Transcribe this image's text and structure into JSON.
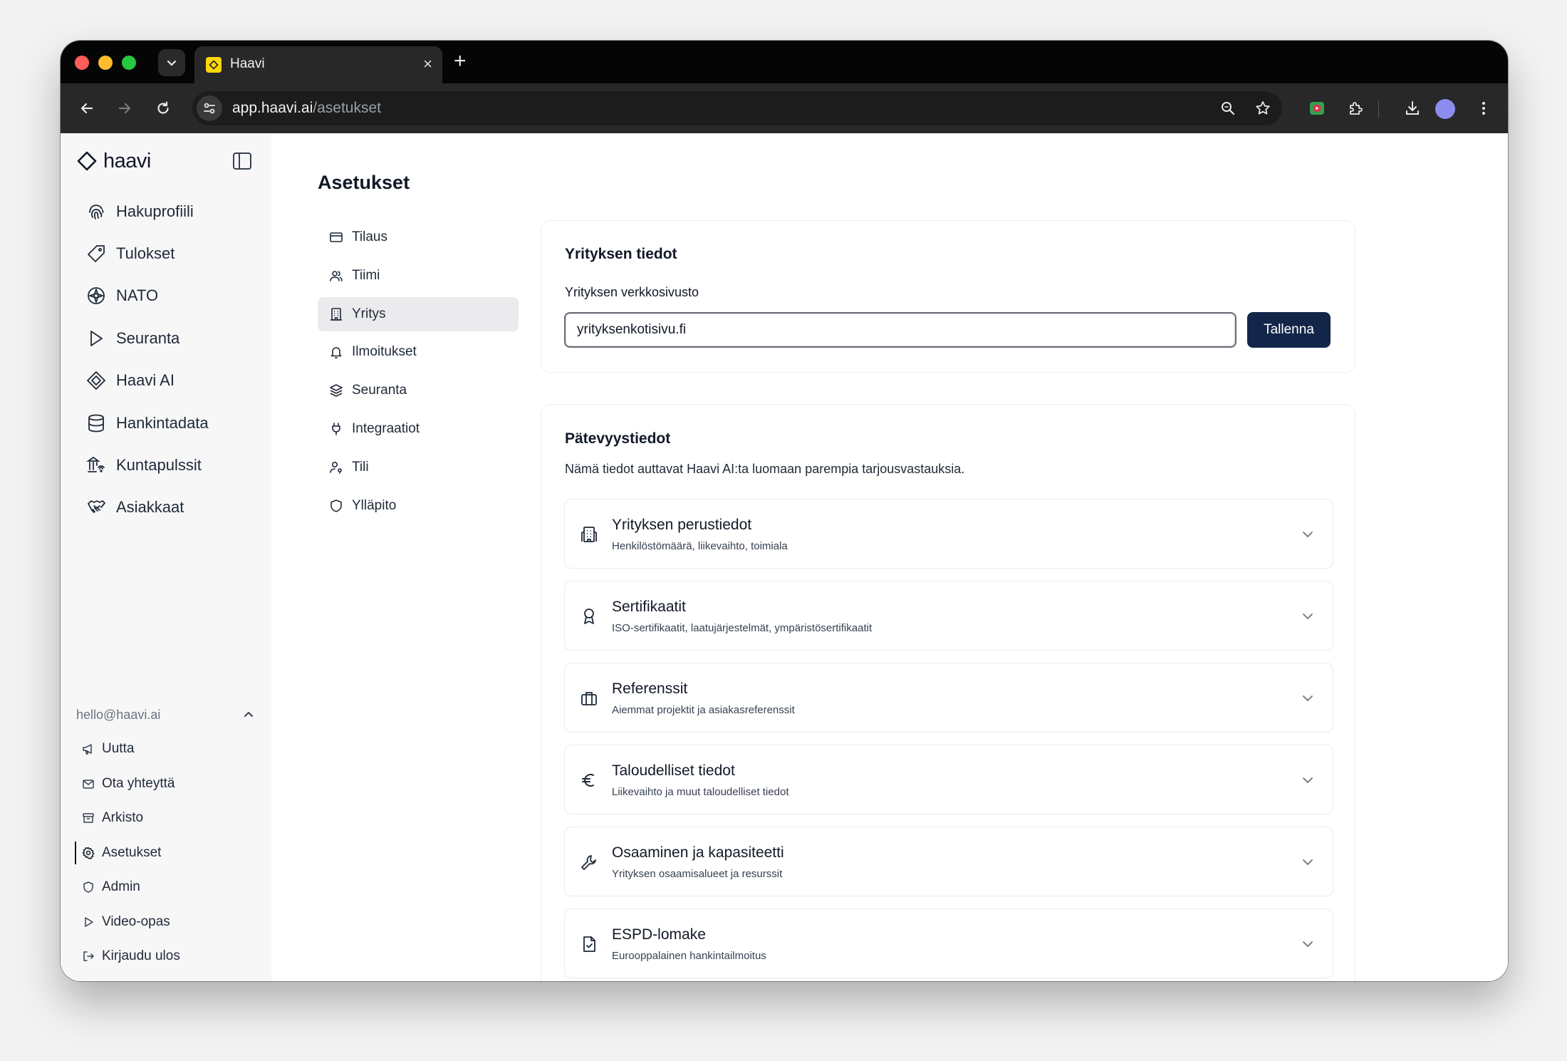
{
  "browser": {
    "tab_title": "Haavi",
    "tab_close": "×",
    "new_tab": "+",
    "url_host": "app.haavi.ai",
    "url_path": "/asetukset"
  },
  "sidebar": {
    "logo_text": "haavi",
    "nav": [
      {
        "label": "Hakuprofiili",
        "icon": "fingerprint-icon"
      },
      {
        "label": "Tulokset",
        "icon": "tag-icon"
      },
      {
        "label": "NATO",
        "icon": "compass-icon"
      },
      {
        "label": "Seuranta",
        "icon": "flag-icon"
      },
      {
        "label": "Haavi AI",
        "icon": "diamond-icon"
      },
      {
        "label": "Hankintadata",
        "icon": "database-icon"
      },
      {
        "label": "Kuntapulssit",
        "icon": "building-signal-icon"
      },
      {
        "label": "Asiakkaat",
        "icon": "handshake-icon"
      }
    ],
    "account": {
      "email": "hello@haavi.ai",
      "items": [
        {
          "label": "Uutta",
          "icon": "megaphone-icon"
        },
        {
          "label": "Ota yhteyttä",
          "icon": "mail-icon"
        },
        {
          "label": "Arkisto",
          "icon": "archive-icon"
        },
        {
          "label": "Asetukset",
          "icon": "gear-icon"
        },
        {
          "label": "Admin",
          "icon": "shield-icon"
        },
        {
          "label": "Video-opas",
          "icon": "play-icon"
        },
        {
          "label": "Kirjaudu ulos",
          "icon": "logout-icon"
        }
      ]
    }
  },
  "settings": {
    "title": "Asetukset",
    "nav": [
      {
        "label": "Tilaus",
        "icon": "credit-card-icon"
      },
      {
        "label": "Tiimi",
        "icon": "users-icon"
      },
      {
        "label": "Yritys",
        "icon": "building-icon"
      },
      {
        "label": "Ilmoitukset",
        "icon": "bell-icon"
      },
      {
        "label": "Seuranta",
        "icon": "layers-icon"
      },
      {
        "label": "Integraatiot",
        "icon": "plug-icon"
      },
      {
        "label": "Tili",
        "icon": "user-key-icon"
      },
      {
        "label": "Ylläpito",
        "icon": "shield-icon"
      }
    ],
    "active_index": 2
  },
  "company": {
    "title": "Yrityksen tiedot",
    "website_label": "Yrityksen verkkosivusto",
    "website_value": "yrityksenkotisivu.fi",
    "save_label": "Tallenna"
  },
  "competence": {
    "title": "Pätevyystiedot",
    "description": "Nämä tiedot auttavat Haavi AI:ta luomaan parempia tarjousvastauksia.",
    "sections": [
      {
        "title": "Yrityksen perustiedot",
        "subtitle": "Henkilöstömäärä, liikevaihto, toimiala",
        "icon": "building-icon"
      },
      {
        "title": "Sertifikaatit",
        "subtitle": "ISO-sertifikaatit, laatujärjestelmät, ympäristösertifikaatit",
        "icon": "award-icon"
      },
      {
        "title": "Referenssit",
        "subtitle": "Aiemmat projektit ja asiakasreferenssit",
        "icon": "briefcase-icon"
      },
      {
        "title": "Taloudelliset tiedot",
        "subtitle": "Liikevaihto ja muut taloudelliset tiedot",
        "icon": "euro-icon"
      },
      {
        "title": "Osaaminen ja kapasiteetti",
        "subtitle": "Yrityksen osaamisalueet ja resurssit",
        "icon": "wrench-icon"
      },
      {
        "title": "ESPD-lomake",
        "subtitle": "Eurooppalainen hankintailmoitus",
        "icon": "file-check-icon"
      }
    ]
  },
  "colors": {
    "primary_button": "#13264a",
    "active_nav_bg": "#ebebed",
    "sidebar_bg": "#f7f7f8"
  }
}
